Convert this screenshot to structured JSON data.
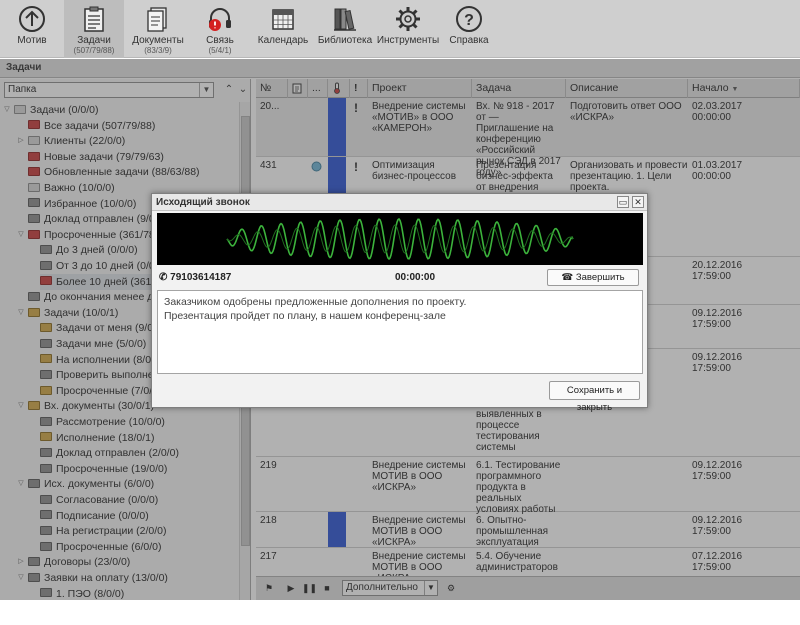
{
  "toolbar": {
    "items": [
      {
        "label": "Мотив",
        "sub": "",
        "icon": "arrow-up-circle-icon"
      },
      {
        "label": "Задачи",
        "sub": "(507/79/88)",
        "icon": "clipboard-icon"
      },
      {
        "label": "Документы",
        "sub": "(83/3/9)",
        "icon": "documents-icon"
      },
      {
        "label": "Связь",
        "sub": "(5/4/1)",
        "icon": "headset-icon"
      },
      {
        "label": "Календарь",
        "sub": "",
        "icon": "calendar-icon"
      },
      {
        "label": "Библиотека",
        "sub": "",
        "icon": "library-icon"
      },
      {
        "label": "Инструменты",
        "sub": "",
        "icon": "gear-icon"
      },
      {
        "label": "Справка",
        "sub": "",
        "icon": "help-icon"
      }
    ]
  },
  "section_title": "Задачи",
  "left_panel": {
    "folder_select": "Папка",
    "tree": [
      {
        "label": "Задачи (0/0/0)",
        "icon": "folder"
      },
      {
        "label": "Все задачи (507/79/88)",
        "icon": "red"
      },
      {
        "label": "Клиенты (22/0/0)",
        "icon": "folder"
      },
      {
        "label": "Новые задачи (79/79/63)",
        "icon": "red"
      },
      {
        "label": "Обновленные задачи (88/63/88)",
        "icon": "red"
      },
      {
        "label": "Важно (10/0/0)",
        "icon": "folder"
      },
      {
        "label": "Избранное (10/0/0)",
        "icon": "gray"
      },
      {
        "label": "Доклад отправлен (9/0/0)",
        "icon": "gray"
      },
      {
        "label": "Просроченные (361/78/8",
        "icon": "red"
      },
      {
        "label": "До 3 дней (0/0/0)",
        "icon": "gray"
      },
      {
        "label": "От 3 до 10 дней (0/0/0)",
        "icon": "gray"
      },
      {
        "label": "Более 10 дней (361/78/",
        "icon": "red"
      },
      {
        "label": "До окончания менее дня",
        "icon": "gray"
      },
      {
        "label": "Задачи (10/0/1)",
        "icon": "amber"
      },
      {
        "label": "Задачи от меня (9/0/1)",
        "icon": "amber"
      },
      {
        "label": "Задачи мне (5/0/0)",
        "icon": "gray"
      },
      {
        "label": "На исполнении (8/0/1",
        "icon": "amber"
      },
      {
        "label": "Проверить выполнени",
        "icon": "gray"
      },
      {
        "label": "Просроченные (7/0/1)",
        "icon": "amber"
      },
      {
        "label": "Вх. документы (30/0/1)",
        "icon": "amber"
      },
      {
        "label": "Рассмотрение (10/0/0)",
        "icon": "gray"
      },
      {
        "label": "Исполнение (18/0/1)",
        "icon": "amber"
      },
      {
        "label": "Доклад отправлен (2/0/0)",
        "icon": "gray"
      },
      {
        "label": "Просроченные (19/0/0)",
        "icon": "gray"
      },
      {
        "label": "Исх. документы (6/0/0)",
        "icon": "gray"
      },
      {
        "label": "Согласование (0/0/0)",
        "icon": "gray"
      },
      {
        "label": "Подписание (0/0/0)",
        "icon": "gray"
      },
      {
        "label": "На регистрации (2/0/0)",
        "icon": "gray"
      },
      {
        "label": "Просроченные (6/0/0)",
        "icon": "gray"
      },
      {
        "label": "Договоры (23/0/0)",
        "icon": "gray"
      },
      {
        "label": "Заявки на оплату (13/0/0)",
        "icon": "gray"
      },
      {
        "label": "1. ПЭО (8/0/0)",
        "icon": "gray"
      }
    ]
  },
  "grid": {
    "columns": {
      "num": "№",
      "dots": "...",
      "bang": "!",
      "project": "Проект",
      "task": "Задача",
      "description": "Описание",
      "start": "Начало"
    },
    "rows": [
      {
        "num": "20...",
        "project": "Внедрение системы «МОТИВ» в ООО «КАМЕРОН»",
        "task": "Вх. № 918 - 2017 от — Приглашение на конференцию «Российский рынок СЭД в 2017 году»",
        "description": "Подготовить ответ ООО «ИСКРА»",
        "start": "02.03.2017 00:00:00"
      },
      {
        "num": "431",
        "project": "Оптимизация бизнес-процессов",
        "task": "Презентация бизнес-эффекта от внедрения системы",
        "description": "Организовать и провести презентацию. 1. Цели проекта.",
        "start": "01.03.2017 00:00:00"
      },
      {
        "num": "",
        "project": "",
        "task": "",
        "description": "",
        "start": "20.12.2016 17:59:00"
      },
      {
        "num": "",
        "project": "",
        "task": "",
        "description": "",
        "start": "09.12.2016 17:59:00"
      },
      {
        "num": "",
        "project": "",
        "task": "выявленных в процессе тестирования системы",
        "description": "",
        "start": "09.12.2016 17:59:00"
      },
      {
        "num": "219",
        "project": "Внедрение системы МОТИВ в ООО «ИСКРА»",
        "task": "6.1. Тестирование программного продукта в реальных условиях работы",
        "description": "",
        "start": "09.12.2016 17:59:00"
      },
      {
        "num": "218",
        "project": "Внедрение системы МОТИВ в ООО «ИСКРА»",
        "task": "6. Опытно-промышленная эксплуатация",
        "description": "",
        "start": "09.12.2016 17:59:00"
      },
      {
        "num": "217",
        "project": "Внедрение системы МОТИВ в ООО «ИСКРА»",
        "task": "5.4. Обучение администраторов",
        "description": "",
        "start": "07.12.2016 17:59:00"
      }
    ],
    "footer_select": "Дополнительно"
  },
  "dialog": {
    "title": "Исходящий звонок",
    "phone": "79103614187",
    "timer": "00:00:00",
    "end_call_label": "Завершить звонок",
    "note_line1": "Заказчиком одобрены предложенные дополнения по проекту.",
    "note_line2": "Презентация пройдет по плану, в нашем конференц-зале",
    "save_label": "Сохранить и закрыть"
  },
  "colors": {
    "priority_blue": "#2a54d6",
    "wave_green": "#3cb33c"
  }
}
